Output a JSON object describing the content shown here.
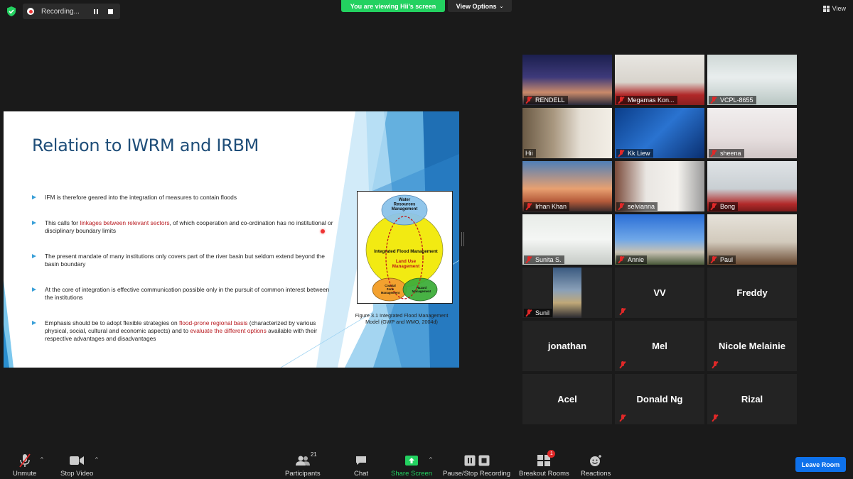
{
  "recording": {
    "label": "Recording..."
  },
  "banner": {
    "viewing": "You are viewing Hii's screen",
    "view_options": "View Options"
  },
  "view_corner": {
    "label": "View"
  },
  "slide": {
    "title": "Relation to IWRM and IRBM",
    "bullets": [
      {
        "pre": "IFM is therefore geared into the integration of measures to contain floods",
        "hl1": "",
        "mid": "",
        "hl2": "",
        "post": ""
      },
      {
        "pre": "This calls for ",
        "hl1": "linkages between relevant sectors",
        "mid": ", of which cooperation and co-ordination has no institutional or disciplinary boundary limits",
        "hl2": "",
        "post": ""
      },
      {
        "pre": "The present mandate of many institutions only covers part of the river basin but seldom extend beyond the basin boundary",
        "hl1": "",
        "mid": "",
        "hl2": "",
        "post": ""
      },
      {
        "pre": "At the core of integration is effective communication possible only in the pursuit of common interest between the institutions",
        "hl1": "",
        "mid": "",
        "hl2": "",
        "post": ""
      },
      {
        "pre": "Emphasis should be to adopt flexible strategies on ",
        "hl1": "flood-prone regional basis",
        "mid": " (characterized by various physical, social, cultural and economic aspects) and to ",
        "hl2": "evaluate the different options",
        "post": " available with their respective advantages and disadvantages"
      }
    ],
    "figure": {
      "water": [
        "Water",
        "Resources",
        "Management"
      ],
      "ifm": "Integrated Flood Management",
      "land": [
        "Land Use",
        "Management"
      ],
      "coastal": [
        "Coastal",
        "Zone",
        "Management"
      ],
      "hazard": [
        "Hazard",
        "Management"
      ],
      "caption": "Figure 3.1 Integrated Flood Management Model (GWP and WMO, 2004d)"
    }
  },
  "participants": [
    {
      "name": "RENDELL",
      "muted": true,
      "video": "night-sky"
    },
    {
      "name": "Megamas Kon...",
      "muted": true,
      "video": "man-mask"
    },
    {
      "name": "VCPL-8655",
      "muted": true,
      "video": "office"
    },
    {
      "name": "Hii",
      "muted": false,
      "video": "woman-glasses",
      "active": true
    },
    {
      "name": "Kk Liew",
      "muted": true,
      "video": "blue-tech"
    },
    {
      "name": "sheena",
      "muted": true,
      "video": "hijab"
    },
    {
      "name": "Irhan Khan",
      "muted": true,
      "video": "bridge"
    },
    {
      "name": "selvianna",
      "muted": true,
      "video": "curtain"
    },
    {
      "name": "Bong",
      "muted": true,
      "video": "office-monkey"
    },
    {
      "name": "Sunita S.",
      "muted": true,
      "video": "whiteboard"
    },
    {
      "name": "Annie",
      "muted": true,
      "video": "house"
    },
    {
      "name": "Paul",
      "muted": true,
      "video": "room"
    },
    {
      "name": "Sunil",
      "muted": true,
      "video": "city"
    },
    {
      "name": "VV",
      "muted": true,
      "video": "none"
    },
    {
      "name": "Freddy",
      "muted": false,
      "video": "none"
    },
    {
      "name": "jonathan",
      "muted": false,
      "video": "none"
    },
    {
      "name": "Mel",
      "muted": true,
      "video": "none"
    },
    {
      "name": "Nicole Melainie",
      "muted": true,
      "video": "none"
    },
    {
      "name": "Acel",
      "muted": false,
      "video": "none"
    },
    {
      "name": "Donald Ng",
      "muted": true,
      "video": "none"
    },
    {
      "name": "Rizal",
      "muted": true,
      "video": "none"
    }
  ],
  "toolbar": {
    "unmute": "Unmute",
    "stop_video": "Stop Video",
    "participants": "Participants",
    "participants_count": "21",
    "chat": "Chat",
    "share_screen": "Share Screen",
    "pause_stop": "Pause/Stop Recording",
    "breakout": "Breakout Rooms",
    "breakout_badge": "1",
    "reactions": "Reactions",
    "leave": "Leave Room"
  },
  "colors": {
    "accent_green": "#23d160",
    "leave_blue": "#0e71eb",
    "mute_red": "#e02828",
    "title_blue": "#1f4e79",
    "highlight_red": "#b8191f",
    "active_border": "#d8e24c"
  }
}
